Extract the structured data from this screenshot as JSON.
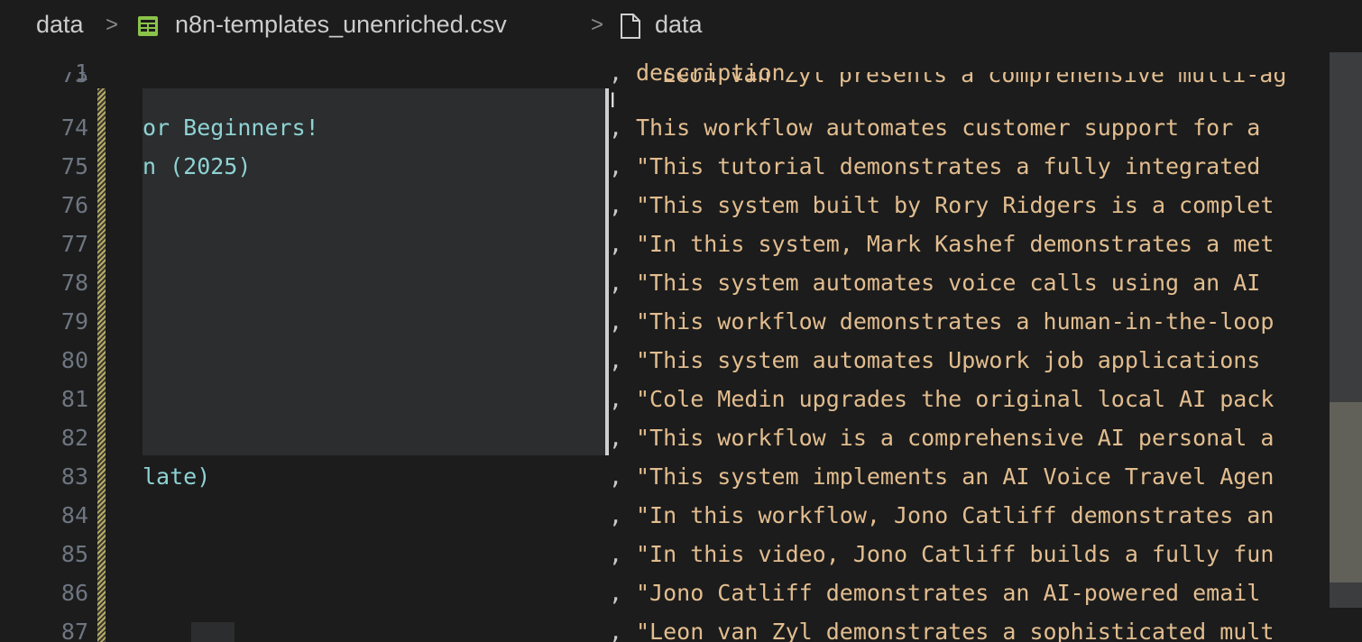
{
  "breadcrumb": {
    "folder": "data",
    "file": "n8n-templates_unenriched.csv",
    "symbol": "data",
    "separator": ">",
    "file_icon": "csv-table-icon",
    "symbol_icon": "document-icon"
  },
  "header_row": {
    "line": "1",
    "comma": ",",
    "column": "description"
  },
  "top_partial": {
    "line": "73",
    "desc": "\"Leon van Zyl presents a comprehensive multi-ag"
  },
  "rows": [
    {
      "line": "74",
      "name": "or Beginners!",
      "comma": ",",
      "desc": "This workflow automates customer support for a"
    },
    {
      "line": "75",
      "name": "n (2025)",
      "comma": ",",
      "desc": "\"This tutorial demonstrates a fully integrated"
    },
    {
      "line": "76",
      "name": "",
      "comma": ",",
      "desc": "\"This system built by Rory Ridgers is a complet"
    },
    {
      "line": "77",
      "name": "",
      "comma": ",",
      "desc": "\"In this system, Mark Kashef demonstrates a met"
    },
    {
      "line": "78",
      "name": "",
      "comma": ",",
      "desc": "\"This system automates voice calls using an AI"
    },
    {
      "line": "79",
      "name": "",
      "comma": ",",
      "desc": "\"This workflow demonstrates a human-in-the-loop"
    },
    {
      "line": "80",
      "name": "",
      "comma": ",",
      "desc": "\"This system automates Upwork job applications"
    },
    {
      "line": "81",
      "name": "",
      "comma": ",",
      "desc": "\"Cole Medin upgrades the original local AI pack"
    },
    {
      "line": "82",
      "name": "",
      "comma": ",",
      "desc": "\"This workflow is a comprehensive AI personal a"
    },
    {
      "line": "83",
      "name": "late)",
      "comma": ",",
      "desc": "\"This system implements an AI Voice Travel Agen"
    },
    {
      "line": "84",
      "name": "",
      "comma": ",",
      "desc": "\"In this workflow, Jono Catliff demonstrates an"
    },
    {
      "line": "85",
      "name": "",
      "comma": ",",
      "desc": "\"In this video, Jono Catliff builds a fully fun"
    },
    {
      "line": "86",
      "name": "",
      "comma": ",",
      "desc": "\"Jono Catliff demonstrates an AI-powered email"
    },
    {
      "line": "87",
      "name": "",
      "comma": ",",
      "desc": "\"Leon van Zyl demonstrates a sophisticated mult"
    }
  ],
  "colors": {
    "background": "#1c1c1c",
    "name_text": "#8fd2d4",
    "desc_text": "#e2bd8f",
    "line_numbers": "#6e7681",
    "selection": "#2b2d2e"
  }
}
